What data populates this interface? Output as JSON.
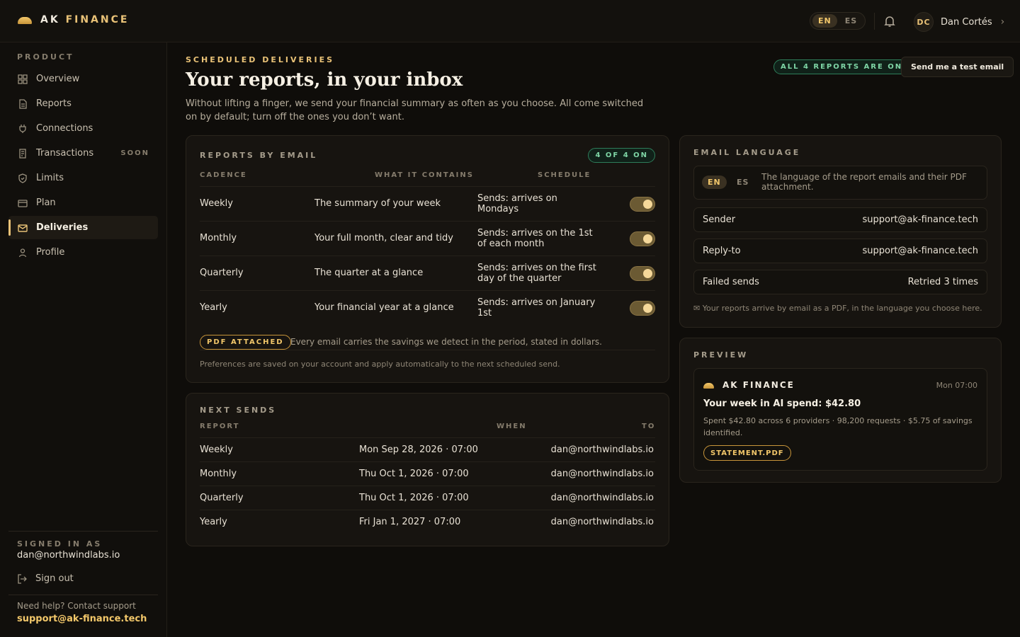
{
  "brand": {
    "part1": "AK",
    "part2": "FINANCE"
  },
  "topbar": {
    "languages": [
      "EN",
      "ES"
    ],
    "user_initials": "DC",
    "user_name": "Dan Cortés"
  },
  "sidebar": {
    "section": "PRODUCT",
    "items": [
      {
        "label": "Overview",
        "icon": "grid-icon"
      },
      {
        "label": "Reports",
        "icon": "document-icon"
      },
      {
        "label": "Connections",
        "icon": "plug-icon"
      },
      {
        "label": "Transactions",
        "icon": "receipt-icon",
        "badge": "SOON"
      },
      {
        "label": "Limits",
        "icon": "shield-icon"
      },
      {
        "label": "Plan",
        "icon": "card-icon"
      },
      {
        "label": "Deliveries",
        "icon": "mail-icon",
        "active": true
      },
      {
        "label": "Profile",
        "icon": "user-icon"
      }
    ],
    "signed_in_label": "SIGNED IN AS",
    "signed_in_email": "dan@northwindlabs.io",
    "sign_out": "Sign out",
    "help_text": "Need help? Contact support",
    "help_link": "support@ak-finance.tech"
  },
  "header": {
    "eyebrow": "SCHEDULED DELIVERIES",
    "title": "Your reports, in your inbox",
    "description": "Without lifting a finger, we send your financial summary as often as you choose. All come switched on by default; turn off the ones you don’t want.",
    "status": "ALL 4 REPORTS ARE ON",
    "test_button": "Send me a test email"
  },
  "reports": {
    "title": "REPORTS BY EMAIL",
    "count": "4 OF 4 ON",
    "columns": [
      "CADENCE",
      "WHAT IT CONTAINS",
      "SCHEDULE"
    ],
    "rows": [
      {
        "cadence": "Weekly",
        "contains": "The summary of your week",
        "schedule": "Sends: arrives on Mondays",
        "on": true
      },
      {
        "cadence": "Monthly",
        "contains": "Your full month, clear and tidy",
        "schedule": "Sends: arrives on the 1st of each month",
        "on": true
      },
      {
        "cadence": "Quarterly",
        "contains": "The quarter at a glance",
        "schedule": "Sends: arrives on the first day of the quarter",
        "on": true
      },
      {
        "cadence": "Yearly",
        "contains": "Your financial year at a glance",
        "schedule": "Sends: arrives on January 1st",
        "on": true
      }
    ],
    "pdf_pill": "PDF ATTACHED",
    "pdf_note": "Every email carries the savings we detect in the period, stated in dollars.",
    "pref_note": "Preferences are saved on your account and apply automatically to the next scheduled send."
  },
  "next_sends": {
    "title": "NEXT SENDS",
    "columns": [
      "REPORT",
      "WHEN",
      "TO"
    ],
    "rows": [
      {
        "report": "Weekly",
        "when": "Mon Sep 28, 2026 · 07:00",
        "to": "dan@northwindlabs.io"
      },
      {
        "report": "Monthly",
        "when": "Thu Oct 1, 2026 · 07:00",
        "to": "dan@northwindlabs.io"
      },
      {
        "report": "Quarterly",
        "when": "Thu Oct 1, 2026 · 07:00",
        "to": "dan@northwindlabs.io"
      },
      {
        "report": "Yearly",
        "when": "Fri Jan 1, 2027 · 07:00",
        "to": "dan@northwindlabs.io"
      }
    ]
  },
  "email_language": {
    "title": "EMAIL LANGUAGE",
    "languages": [
      "EN",
      "ES"
    ],
    "description": "The language of the report emails and their PDF attachment.",
    "sender_label": "Sender",
    "sender_value": "support@ak-finance.tech",
    "reply_label": "Reply-to",
    "reply_value": "support@ak-finance.tech",
    "failed_label": "Failed sends",
    "failed_value": "Retried 3 times",
    "note": "✉ Your reports arrive by email as a PDF, in the language you choose here."
  },
  "preview": {
    "title": "PREVIEW",
    "brand": "FINANCE",
    "brand_prefix": "AK",
    "time": "Mon 07:00",
    "headline": "Your week in AI spend: $42.80",
    "body": "Spent $42.80 across 6 providers · 98,200 requests · $5.75 of savings identified.",
    "attachment": "STATEMENT.PDF"
  },
  "colors": {
    "accent": "#e9c277",
    "success": "#7fd6a6",
    "background": "#0f0d0a"
  }
}
